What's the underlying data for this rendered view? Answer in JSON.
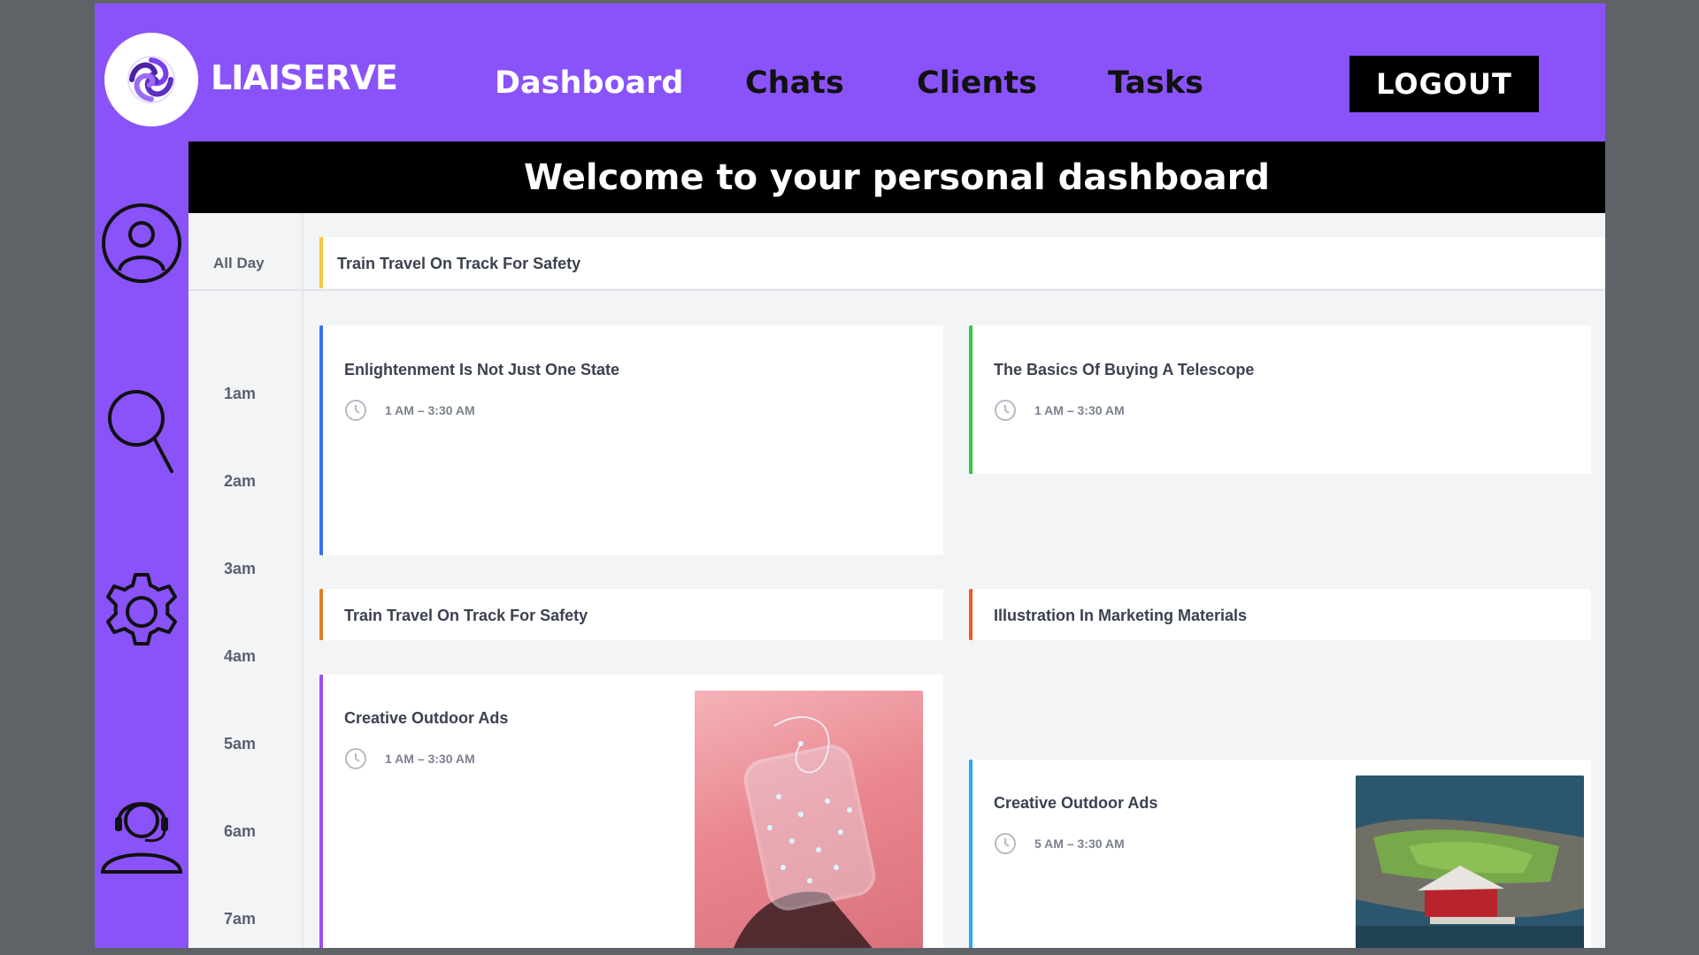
{
  "brand": {
    "name": "LIAISERVE"
  },
  "nav": {
    "items": [
      {
        "label": "Dashboard",
        "active": true
      },
      {
        "label": "Chats",
        "active": false
      },
      {
        "label": "Clients",
        "active": false
      },
      {
        "label": "Tasks",
        "active": false
      }
    ],
    "logout_label": "LOGOUT"
  },
  "sidebar": {
    "icons": [
      "user-profile-icon",
      "search-icon",
      "gear-icon",
      "support-headset-icon"
    ]
  },
  "banner": {
    "text": "Welcome to your personal dashboard"
  },
  "calendar": {
    "all_day_label": "All Day",
    "all_day_event": {
      "title": "Train Travel On Track For Safety",
      "color": "#f5c842"
    },
    "hours": [
      "1am",
      "2am",
      "3am",
      "4am",
      "5am",
      "6am",
      "7am"
    ],
    "events": [
      {
        "title": "Enlightenment Is Not Just One State",
        "time": "1 AM – 3:30 AM",
        "color": "#3b6ff5"
      },
      {
        "title": "The Basics Of Buying A Telescope",
        "time": "1 AM – 3:30 AM",
        "color": "#2ec84a"
      },
      {
        "title": "Train Travel On Track For Safety",
        "time": "",
        "color": "#e07d28"
      },
      {
        "title": "Illustration In Marketing Materials",
        "time": "",
        "color": "#f0582a"
      },
      {
        "title": "Creative Outdoor Ads",
        "time": "1 AM – 3:30 AM",
        "color": "#9b4df0"
      },
      {
        "title": "Creative Outdoor Ads",
        "time": "5 AM – 3:30 AM",
        "color": "#2aa8f0"
      }
    ]
  },
  "colors": {
    "accent": "#8a53fa",
    "banner_bg": "#000000",
    "page_bg": "#5f6368"
  }
}
